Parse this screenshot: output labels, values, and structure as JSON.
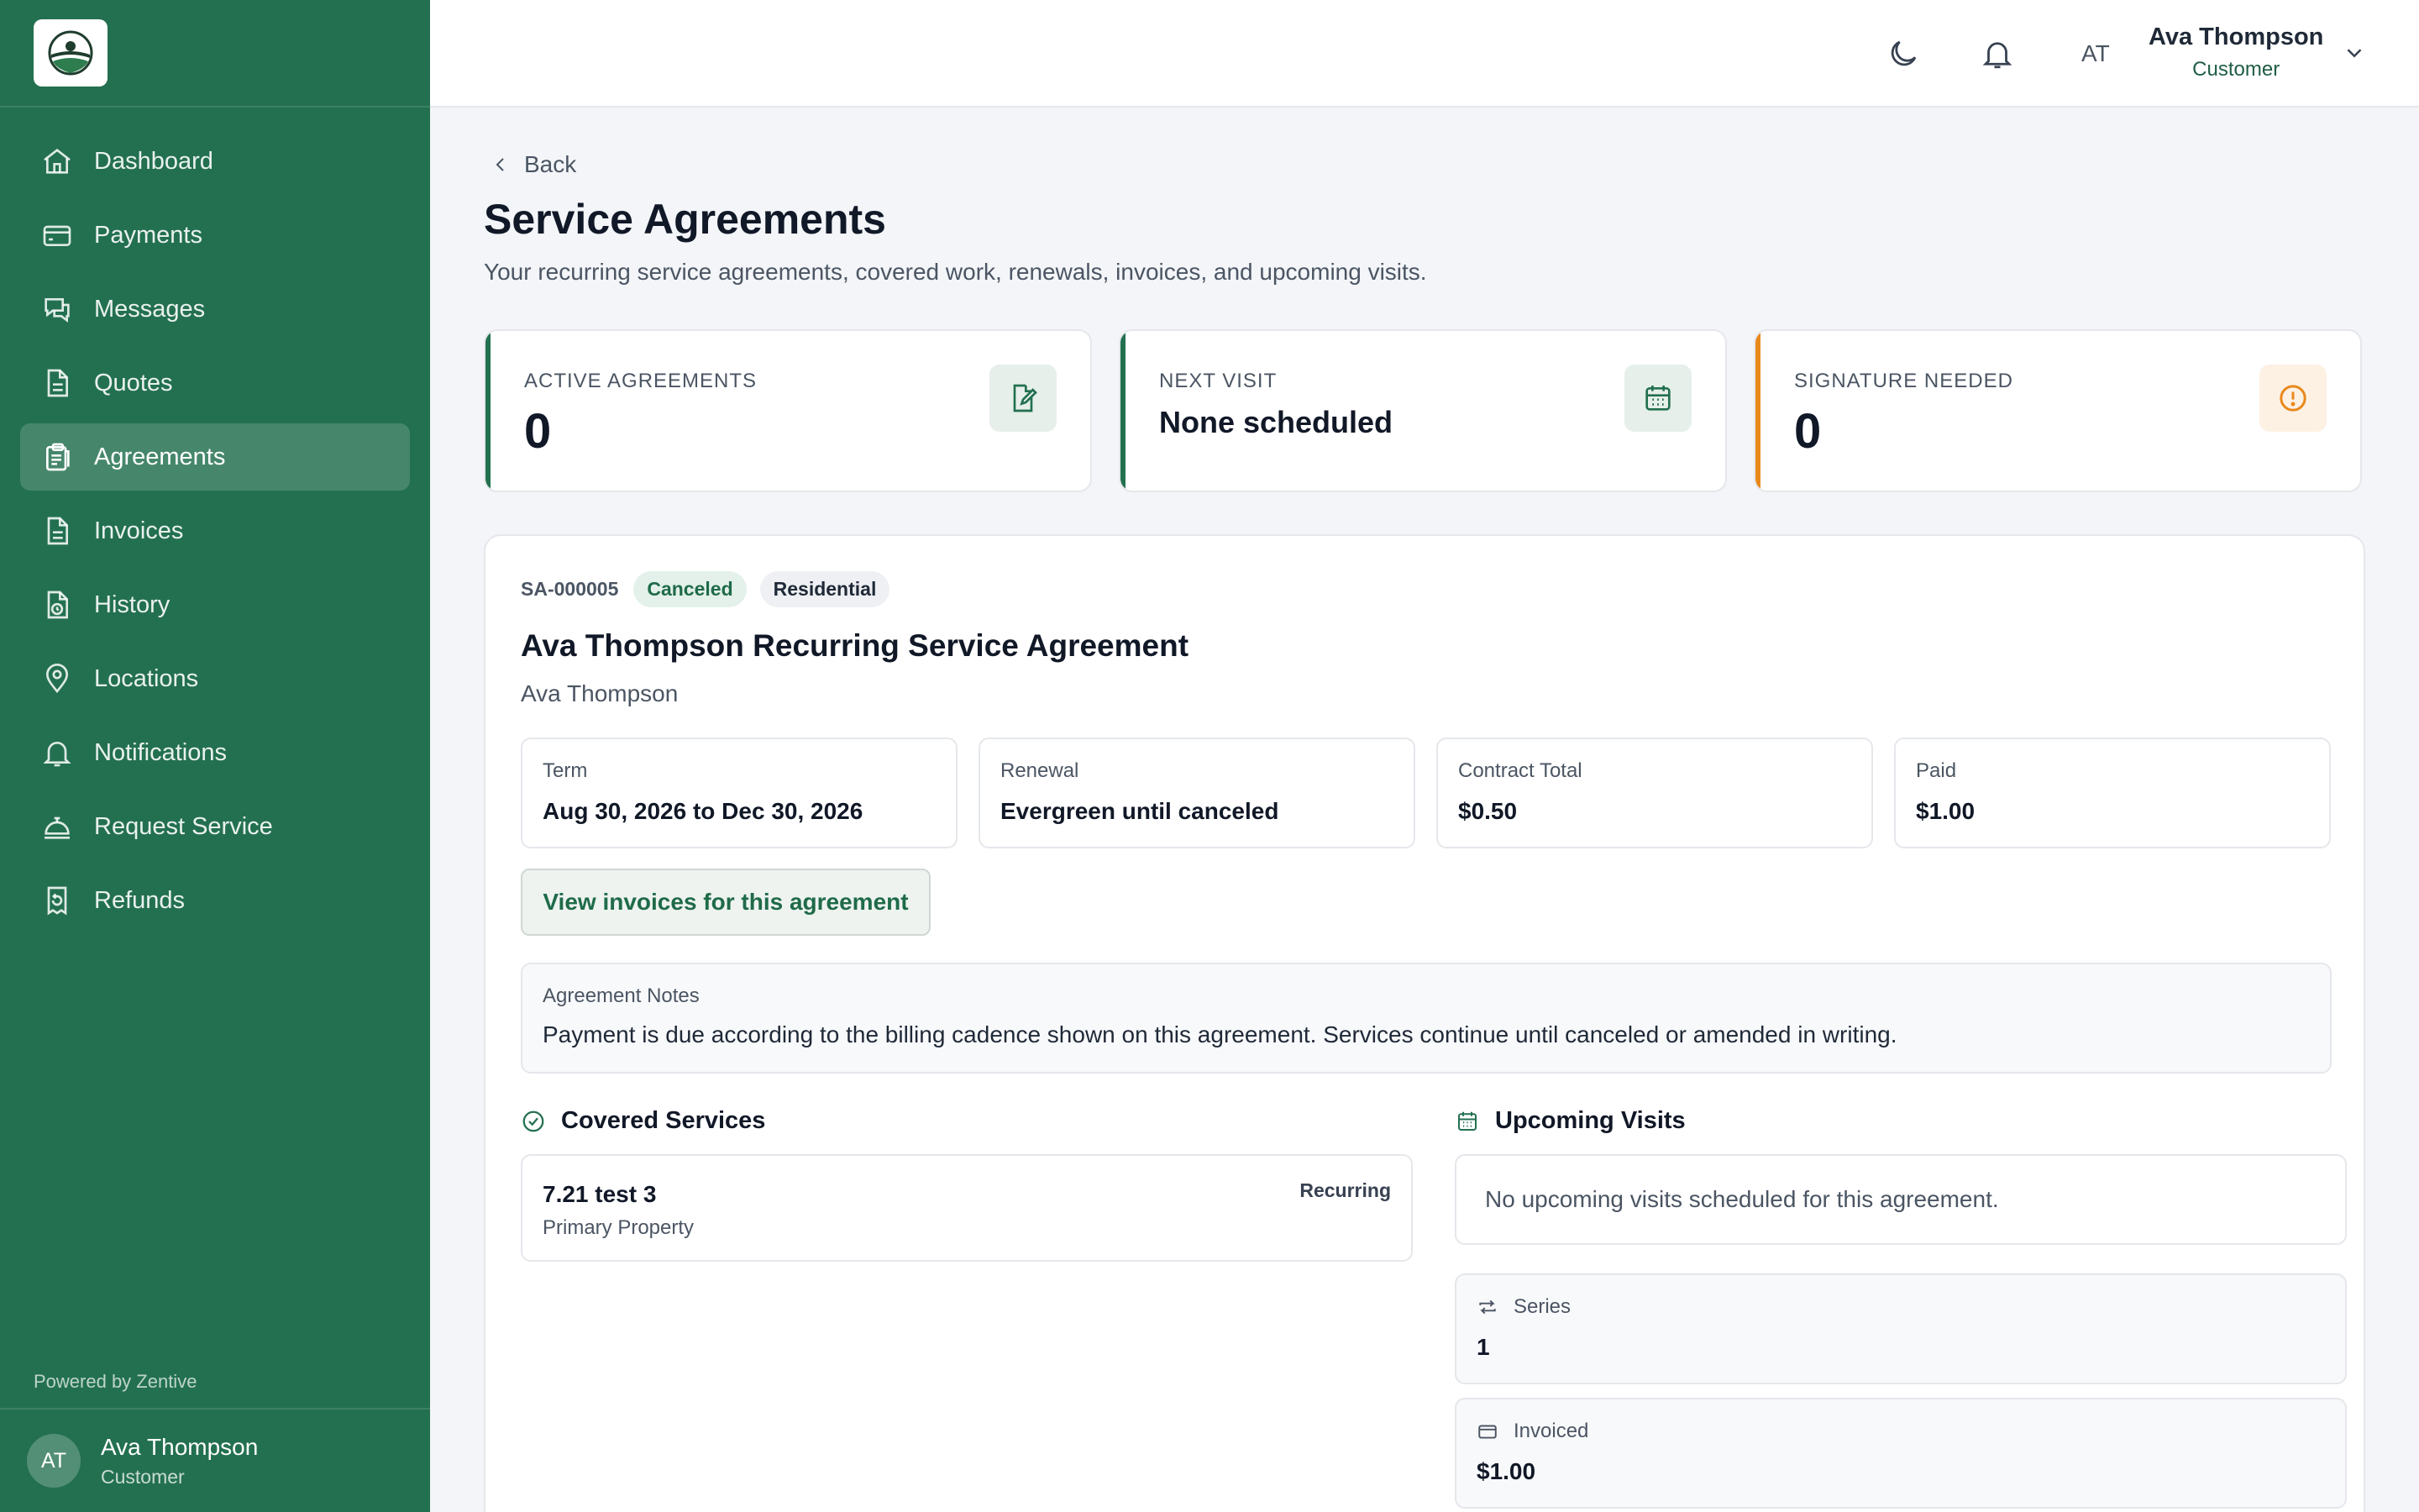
{
  "sidebar": {
    "logo_alt": "company-logo",
    "items": [
      {
        "label": "Dashboard",
        "icon": "home-icon"
      },
      {
        "label": "Payments",
        "icon": "credit-card-icon"
      },
      {
        "label": "Messages",
        "icon": "chat-icon"
      },
      {
        "label": "Quotes",
        "icon": "document-icon"
      },
      {
        "label": "Agreements",
        "icon": "clipboard-icon",
        "active": true
      },
      {
        "label": "Invoices",
        "icon": "document-icon"
      },
      {
        "label": "History",
        "icon": "history-file-icon"
      },
      {
        "label": "Locations",
        "icon": "map-pin-icon"
      },
      {
        "label": "Notifications",
        "icon": "bell-icon"
      },
      {
        "label": "Request Service",
        "icon": "service-bell-icon"
      },
      {
        "label": "Refunds",
        "icon": "refund-receipt-icon"
      }
    ],
    "powered_by": "Powered by Zentive",
    "user": {
      "initials": "AT",
      "name": "Ava Thompson",
      "role": "Customer"
    }
  },
  "topbar": {
    "initials": "AT",
    "user_name": "Ava Thompson",
    "user_role": "Customer"
  },
  "page": {
    "back_label": "Back",
    "title": "Service Agreements",
    "subtitle": "Your recurring service agreements, covered work, renewals, invoices, and upcoming visits."
  },
  "stats": [
    {
      "label": "ACTIVE AGREEMENTS",
      "value": "0",
      "accent": "#237050",
      "icon": "document-edit-icon"
    },
    {
      "label": "NEXT VISIT",
      "value": "None scheduled",
      "accent": "#237050",
      "icon": "calendar-icon"
    },
    {
      "label": "SIGNATURE NEEDED",
      "value": "0",
      "accent": "#e8891c",
      "icon": "alert-circle-icon"
    }
  ],
  "agreement": {
    "code": "SA-000005",
    "status": "Canceled",
    "type": "Residential",
    "title": "Ava Thompson Recurring Service Agreement",
    "customer": "Ava Thompson",
    "info": [
      {
        "label": "Term",
        "value": "Aug 30, 2026 to Dec 30, 2026"
      },
      {
        "label": "Renewal",
        "value": "Evergreen until canceled"
      },
      {
        "label": "Contract Total",
        "value": "$0.50"
      },
      {
        "label": "Paid",
        "value": "$1.00"
      }
    ],
    "view_invoices_label": "View invoices for this agreement",
    "notes_label": "Agreement Notes",
    "notes_text": "Payment is due according to the billing cadence shown on this agreement. Services continue until canceled or amended in writing.",
    "covered_heading": "Covered Services",
    "services": [
      {
        "name": "7.21 test 3",
        "property": "Primary Property",
        "type": "Recurring"
      }
    ],
    "visits_heading": "Upcoming Visits",
    "visits_empty": "No upcoming visits scheduled for this agreement.",
    "series_label": "Series",
    "series_value": "1",
    "invoiced_label": "Invoiced",
    "invoiced_value": "$1.00"
  },
  "colors": {
    "sidebar": "#237050",
    "accent_orange": "#e8891c",
    "page_bg": "#f3f5f8"
  }
}
